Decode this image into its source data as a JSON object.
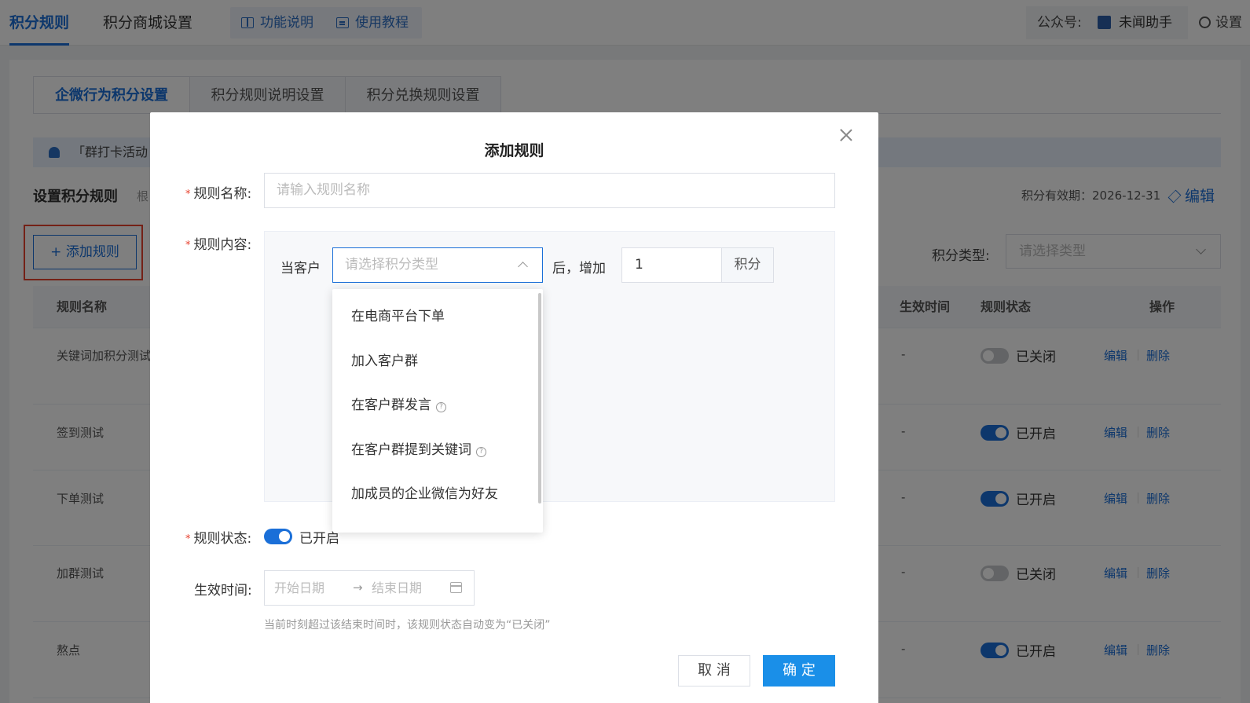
{
  "topbar": {
    "tabs": [
      "积分规则",
      "积分商城设置"
    ],
    "help": [
      "功能说明",
      "使用教程"
    ],
    "account_label": "公众号:",
    "account_name": "未闻助手",
    "settings": "设置"
  },
  "subtabs": [
    "企微行为积分设置",
    "积分规则说明设置",
    "积分兑换规则设置"
  ],
  "notice": "「群打卡活动",
  "section": {
    "title": "设置积分规则",
    "hint": "根",
    "validity": "积分有效期：2026-12-31",
    "edit": "编辑",
    "add_button": "+ 添加规则",
    "filter_label": "积分类型:",
    "filter_placeholder": "请选择类型"
  },
  "table": {
    "headers": {
      "name": "规则名称",
      "time": "生效时间",
      "status": "规则状态",
      "ops": "操作"
    },
    "rows": [
      {
        "name": "关键词加积分测试",
        "time": "-",
        "status": "已关闭",
        "on": false
      },
      {
        "name": "签到测试",
        "time": "-",
        "status": "已开启",
        "on": true
      },
      {
        "name": "下单测试",
        "time": "-",
        "status": "已开启",
        "on": true
      },
      {
        "name": "加群测试",
        "time": "-",
        "status": "已关闭",
        "on": false
      },
      {
        "name": "熬点",
        "time": "-",
        "status": "已开启",
        "on": true
      }
    ],
    "op_edit": "编辑",
    "op_delete": "删除"
  },
  "modal": {
    "title": "添加规则",
    "name_label": "规则名称:",
    "name_placeholder": "请输入规则名称",
    "content_label": "规则内容:",
    "when": "当客户",
    "type_placeholder": "请选择积分类型",
    "after": "后，增加",
    "points_value": "1",
    "points_suffix": "积分",
    "dropdown": [
      "在电商平台下单",
      "加入客户群",
      "在客户群发言",
      "在客户群提到关键词",
      "加成员的企业微信为好友"
    ],
    "status_label": "规则状态:",
    "status_value": "已开启",
    "time_label": "生效时间:",
    "start_placeholder": "开始日期",
    "end_placeholder": "结束日期",
    "hint": "当前时刻超过该结束时间时，该规则状态自动变为“已关闭”",
    "cancel": "取 消",
    "confirm": "确 定"
  }
}
